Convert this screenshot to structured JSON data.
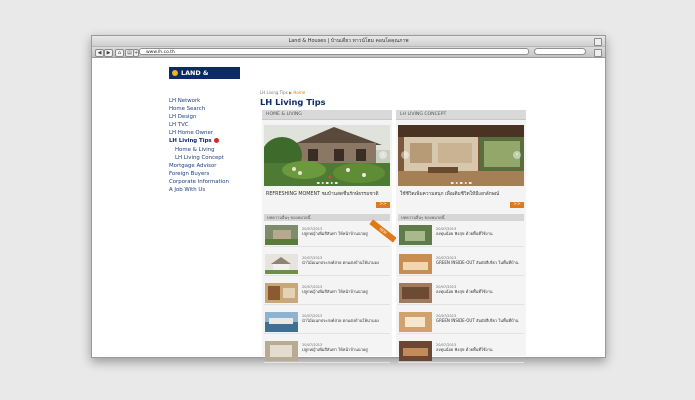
{
  "window": {
    "title": "Land & Houses | บ้านเดี่ยว ทาวน์โฮม คอนโดคุณภาพ",
    "url": "www.lh.co.th"
  },
  "logo": {
    "text": "LAND & HOUSES"
  },
  "sidenav": [
    {
      "label": "LH Network"
    },
    {
      "label": "Home Search"
    },
    {
      "label": "LH Design"
    },
    {
      "label": "LH TVC"
    },
    {
      "label": "LH Home Owner"
    },
    {
      "label": "LH Living Tips",
      "active": true
    },
    {
      "label": "Home & Living",
      "sub": true
    },
    {
      "label": "LH Living Concept",
      "sub": true
    },
    {
      "label": "Mortgage Advisor"
    },
    {
      "label": "Foreign Buyers"
    },
    {
      "label": "Corporate Information"
    },
    {
      "label": "A Job With Us"
    }
  ],
  "breadcrumb": {
    "parent": "LH Living Tips",
    "current": "Home"
  },
  "page_title": "LH Living Tips",
  "panels": [
    {
      "head": "HOME & LIVING",
      "caption": "REFRESHING MOMENT ชมบ้านสดชื่นรักษ์ธรรมชาติ",
      "more": ">>",
      "list_head": "บทความอื่นๆ ของหมวดนี้",
      "ribbon": "NEW",
      "items": [
        {
          "date": "20/07/2013",
          "title": "ปลูกหญ้าเพิ่มสีสันท่า ให้หน้าบ้านน่าอยู่"
        },
        {
          "date": "20/07/2013",
          "title": "นำไม้อเนกประสงค์สวย ตกแต่งบ้านให้น่ามอง"
        },
        {
          "date": "20/07/2013",
          "title": "ปลูกหญ้าเพิ่มสีสันท่า ให้หน้าบ้านน่าอยู่"
        },
        {
          "date": "20/07/2013",
          "title": "นำไม้อเนกประสงค์สวย ตกแต่งบ้านให้น่ามอง"
        },
        {
          "date": "20/07/2013",
          "title": "ปลูกหญ้าเพิ่มสีสันท่า ให้หน้าบ้านน่าอยู่"
        }
      ]
    },
    {
      "head": "LH LIVING CONCEPT",
      "caption": "ใช้ชีวิตเพิ่มความสนุก เพื่อเติมชีวิตให้มีเอกลักษณ์",
      "more": ">>",
      "list_head": "บทความอื่นๆ ของหมวดนี้",
      "items": [
        {
          "date": "20/07/2013",
          "title": "ลงทุนน้อย ฟังสุข ด้วยพื้นที่ใช้งาน"
        },
        {
          "date": "20/07/2013",
          "title": "GREEN INSIDE-OUT สัมผัสสีเขียว ในพื้นที่บ้าน"
        },
        {
          "date": "20/07/2013",
          "title": "ลงทุนน้อย ฟังสุข ด้วยพื้นที่ใช้งาน"
        },
        {
          "date": "20/07/2013",
          "title": "GREEN INSIDE-OUT สัมผัสสีเขียว ในพื้นที่บ้าน"
        },
        {
          "date": "20/07/2013",
          "title": "ลงทุนน้อย ฟังสุข ด้วยพื้นที่ใช้งาน"
        }
      ]
    }
  ],
  "colors": {
    "brand": "#0d2a68",
    "accent": "#e07a17"
  }
}
